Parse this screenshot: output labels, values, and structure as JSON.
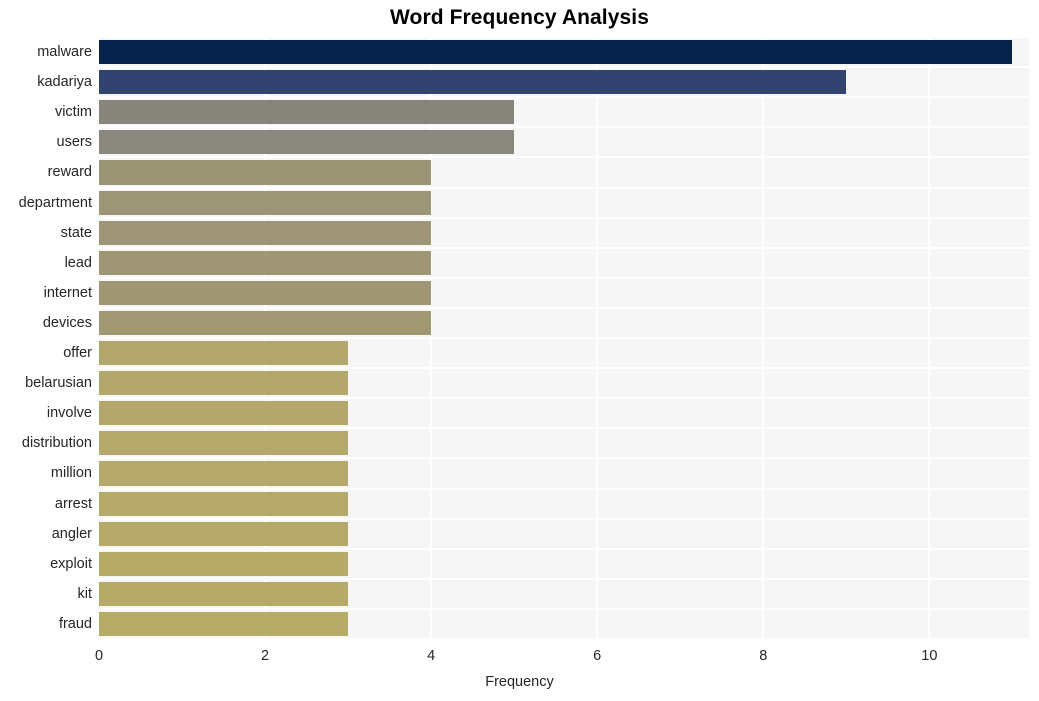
{
  "chart_data": {
    "type": "bar",
    "orientation": "horizontal",
    "title": "Word Frequency Analysis",
    "xlabel": "Frequency",
    "ylabel": "",
    "xlim": [
      0,
      11.2
    ],
    "xticks": [
      0,
      2,
      4,
      6,
      8,
      10
    ],
    "xtick_labels": [
      "0",
      "2",
      "4",
      "6",
      "8",
      "10"
    ],
    "grid": true,
    "grid_color": "#ffffff",
    "plot_background": "#f6f6f7",
    "legend": null,
    "categories": [
      "malware",
      "kadariya",
      "victim",
      "users",
      "reward",
      "department",
      "state",
      "lead",
      "internet",
      "devices",
      "offer",
      "belarusian",
      "involve",
      "distribution",
      "million",
      "arrest",
      "angler",
      "exploit",
      "kit",
      "fraud"
    ],
    "values": [
      11,
      9,
      5,
      5,
      4,
      4,
      4,
      4,
      4,
      4,
      3,
      3,
      3,
      3,
      3,
      3,
      3,
      3,
      3,
      3
    ],
    "bar_colors": [
      "#06224b",
      "#33436f",
      "#87857b",
      "#8a887c",
      "#9b9576",
      "#9c9576",
      "#9d9575",
      "#9e9674",
      "#9f9773",
      "#a09873",
      "#b2a66c",
      "#b3a76c",
      "#b3a76b",
      "#b4a86b",
      "#b4a86a",
      "#b5a96a",
      "#b5a969",
      "#b6aa69",
      "#b6aa68",
      "#b7ab68"
    ]
  }
}
